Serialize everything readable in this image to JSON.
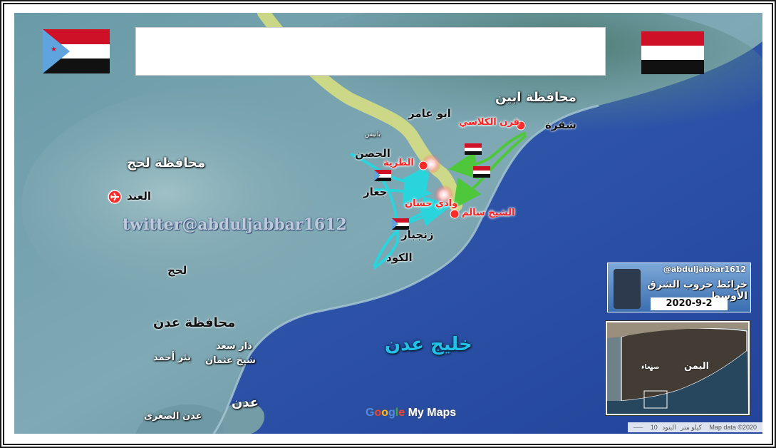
{
  "labels": {
    "gov_abyan": "محافظة ابين",
    "gov_lahj": "محافظة لحج",
    "gov_aden": "محافظة عدن",
    "shuqra": "شقرة",
    "abu_amer": "ابو عامر",
    "al_hisn": "الحصن",
    "jaar": "جعار",
    "zinjibar": "زنجبار",
    "al_kawd": "الكود",
    "al_anad": "العند",
    "lahj": "لحج",
    "dar_saad": "دار سعد",
    "sheikh_othman": "شيخ عثمان",
    "bir_ahmed": "بئر أحمد",
    "aden": "عدن",
    "aden_sughra": "عدن الصغرى",
    "gulf_aden": "خليج عدن",
    "qarn_kalasi": "قرن الكلاسي",
    "al_tariya": "الطرية",
    "wadi_hassan": "وادي حسان",
    "sheikh_salem": "الشيخ سالم",
    "bateis": "باتيس"
  },
  "watermark": "twitter@abduljabbar1612",
  "badge": {
    "handle": "@abduljabbar1612",
    "title": "خرائط حروب الشرق الأوسط",
    "date": "2020-9-2"
  },
  "inset": {
    "country": "اليمن",
    "capital": "صنعاء"
  },
  "brand": {
    "g1": "G",
    "g2": "o",
    "g3": "o",
    "g4": "g",
    "g5": "l",
    "g6": "e",
    "rest": " My Maps"
  },
  "attribution": {
    "data": "Map data ©2020",
    "scale": "10 كيلو متر",
    "terms": "البنود"
  },
  "colors": {
    "sea": "#2a50a6",
    "land": "#5e8f9d",
    "front_line": "#e8ea7a",
    "attack_stc": "#2ad4dc",
    "attack_gov": "#4ec83a",
    "clash_marker": "#ff2a2a"
  },
  "icons": {
    "airport": "airplane-icon",
    "flag_south": "south-yemen-flag-icon",
    "flag_yemen": "yemen-flag-icon"
  }
}
